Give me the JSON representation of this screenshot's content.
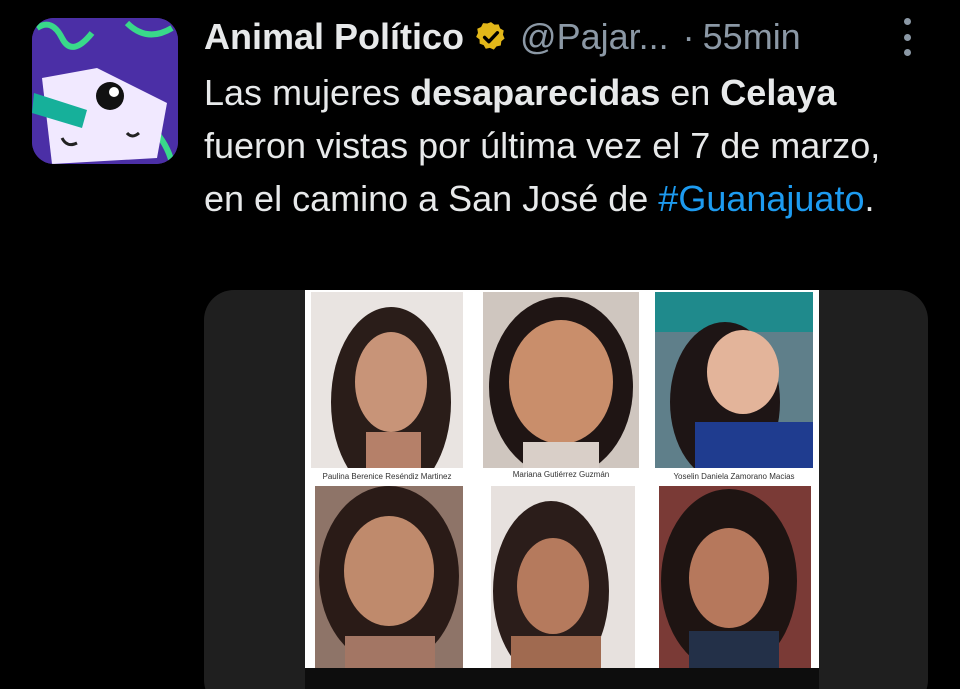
{
  "post": {
    "author": "Animal Político",
    "handle": "@Pajar...",
    "separator": "·",
    "time": "55min",
    "text": {
      "part1": "Las mujeres ",
      "bold1": "desaparecidas",
      "part2": " en ",
      "bold2": "Celaya",
      "part3": " fueron vistas por última vez el 7 de marzo, en el camino a San José de ",
      "hashtag": "#Guanajuato",
      "part4": "."
    }
  },
  "icons": {
    "verified": "verified-badge-icon",
    "more": "more-options-icon"
  },
  "colors": {
    "background": "#000000",
    "text": "#e7e9ea",
    "secondary": "#8b98a5",
    "link": "#1d9bf0",
    "verified_gold": "#e2b719"
  },
  "media": {
    "captions": [
      "Paulina Berenice Reséndiz Martinez",
      "Mariana Gutiérrez Guzmán",
      "Yoselin Daniela Zamorano Macias"
    ]
  }
}
